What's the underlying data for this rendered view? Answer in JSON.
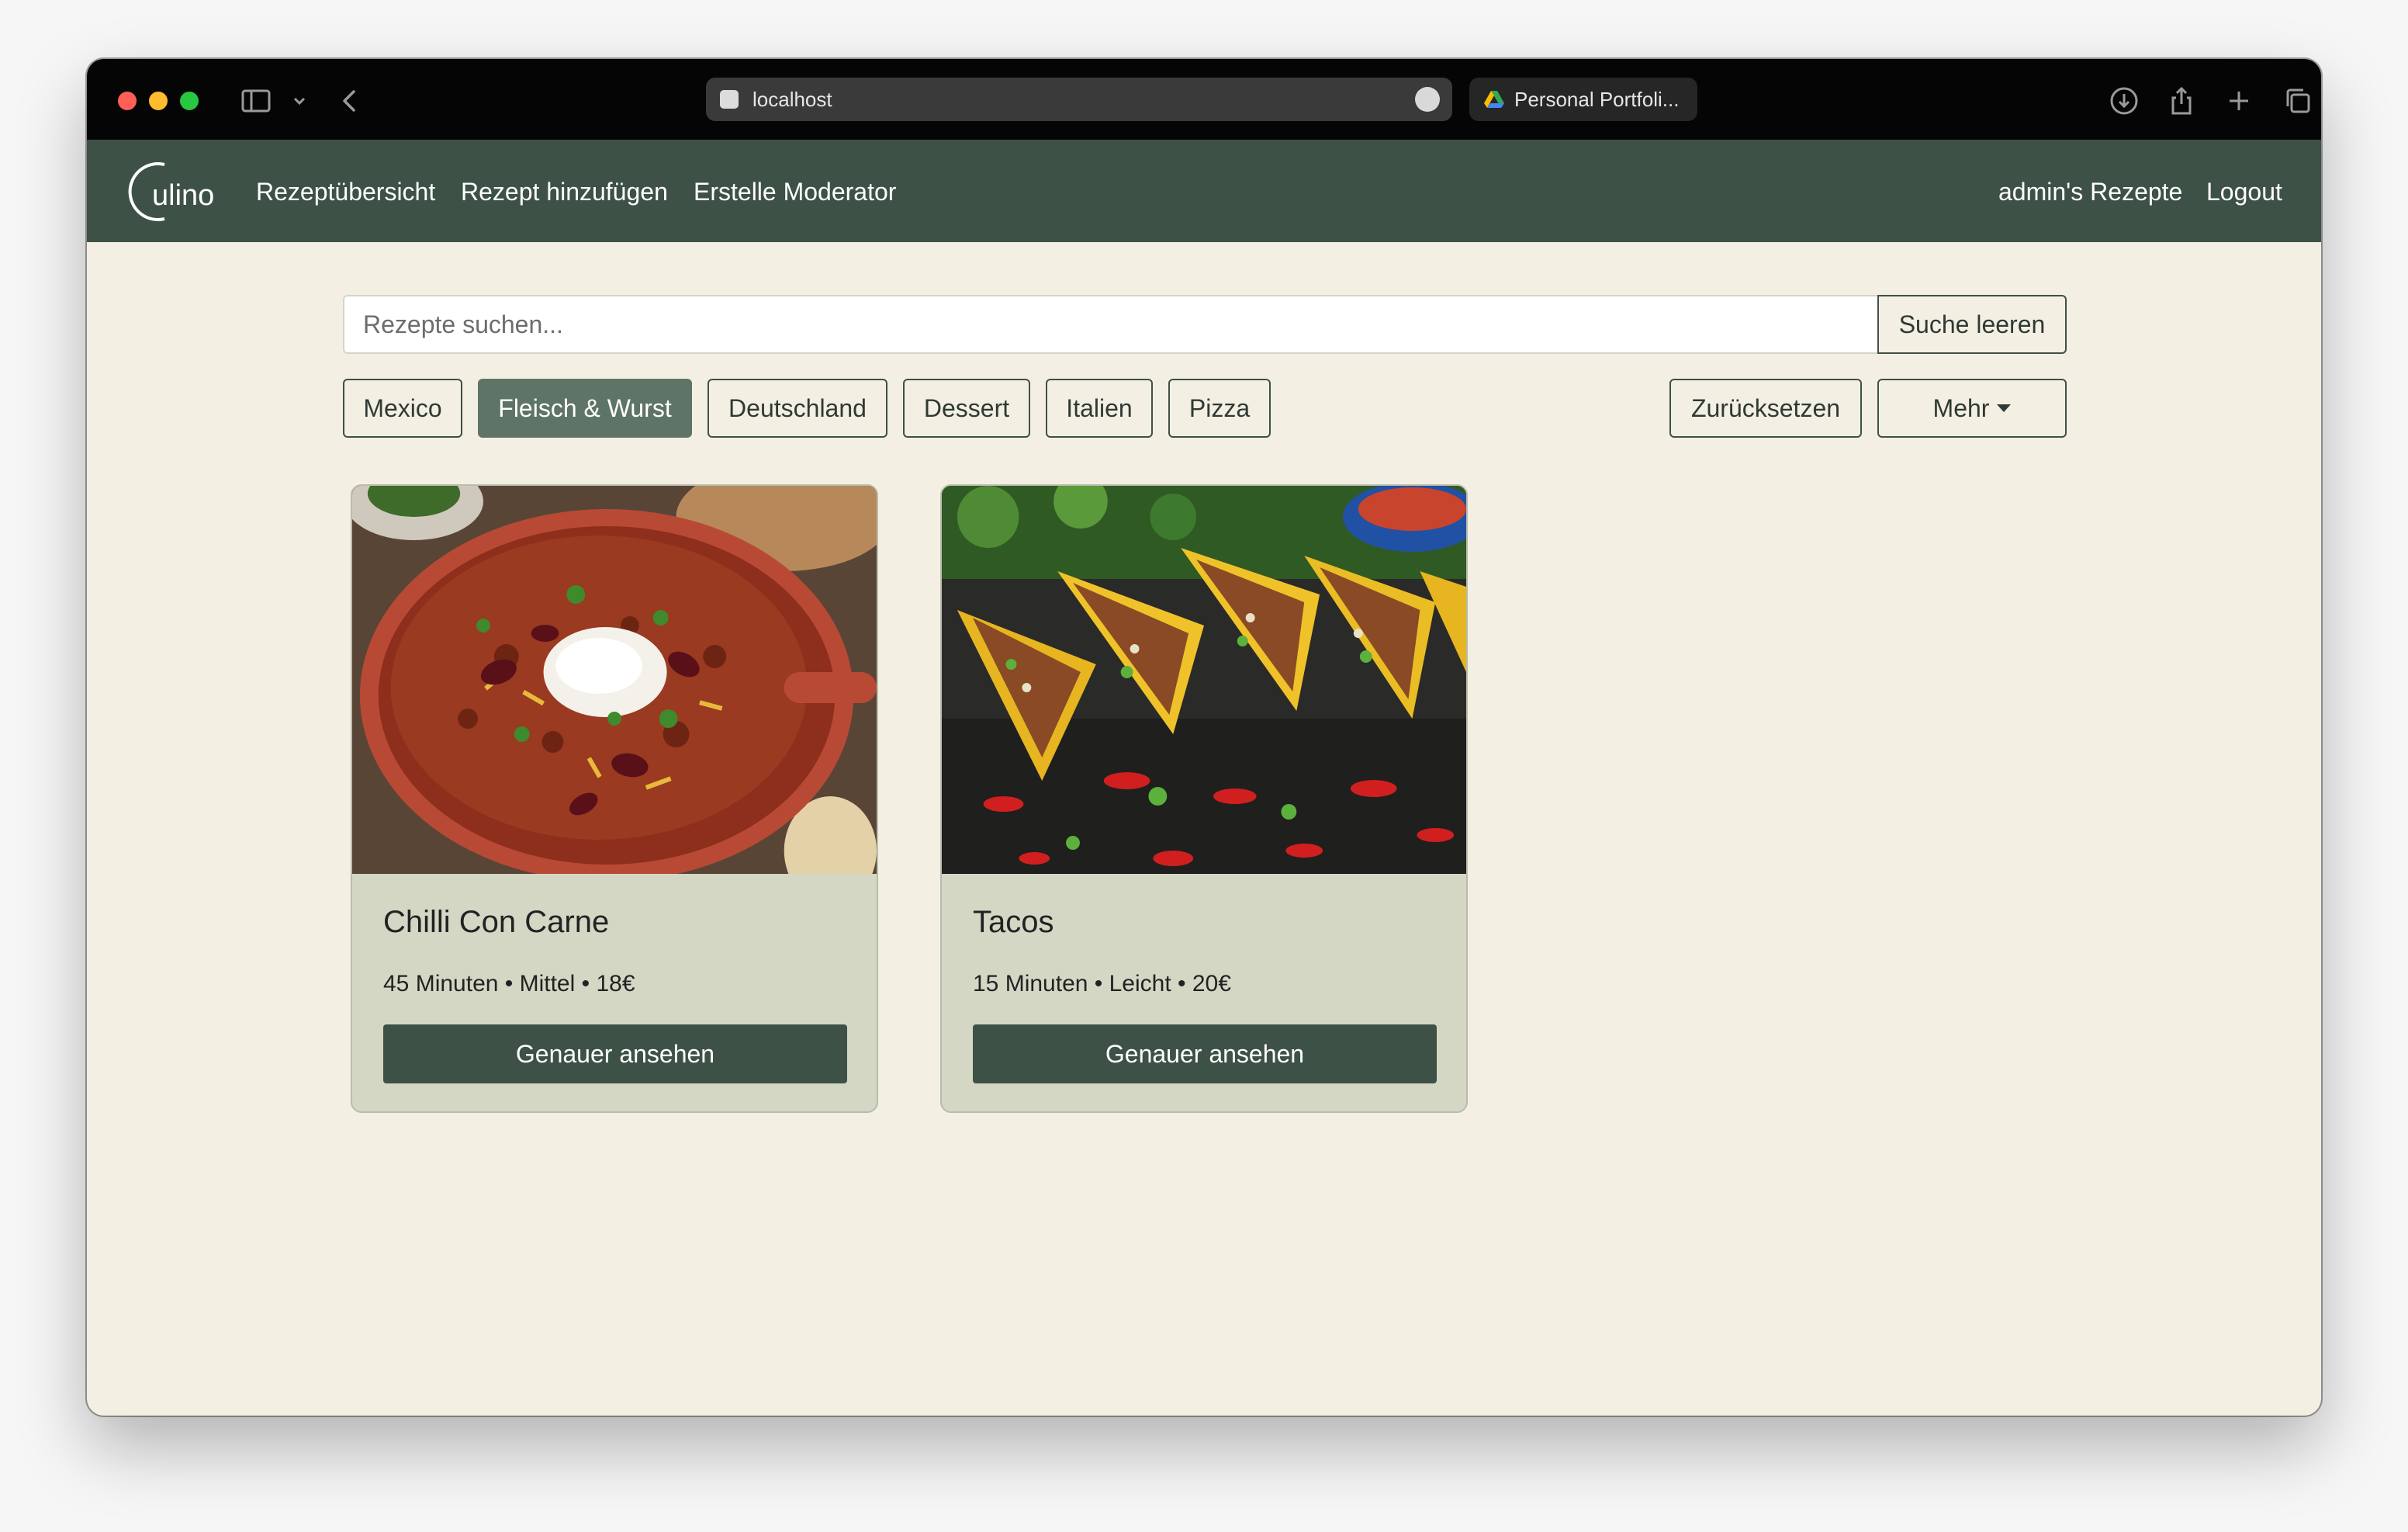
{
  "browser": {
    "url": "localhost",
    "second_tab_title": "Personal Portfoli..."
  },
  "navbar": {
    "logo_text": "ulino",
    "links": [
      "Rezeptübersicht",
      "Rezept hinzufügen",
      "Erstelle Moderator"
    ],
    "right_links": [
      "admin's Rezepte",
      "Logout"
    ]
  },
  "search": {
    "placeholder": "Rezepte suchen...",
    "value": "",
    "clear_label": "Suche leeren"
  },
  "filters": {
    "tags": [
      {
        "label": "Mexico",
        "active": false
      },
      {
        "label": "Fleisch & Wurst",
        "active": true
      },
      {
        "label": "Deutschland",
        "active": false
      },
      {
        "label": "Dessert",
        "active": false
      },
      {
        "label": "Italien",
        "active": false
      },
      {
        "label": "Pizza",
        "active": false
      }
    ],
    "reset_label": "Zurücksetzen",
    "more_label": "Mehr"
  },
  "recipes": [
    {
      "title": "Chilli Con Carne",
      "meta": "45 Minuten • Mittel • 18€",
      "button": "Genauer ansehen",
      "image": "chili-photo"
    },
    {
      "title": "Tacos",
      "meta": "15 Minuten • Leicht • 20€",
      "button": "Genauer ansehen",
      "image": "tacos-photo"
    }
  ],
  "colors": {
    "navbar": "#3e5146",
    "page_background": "#f4efe3",
    "card_background": "#d4d7c4",
    "active_filter": "#5e7466"
  }
}
